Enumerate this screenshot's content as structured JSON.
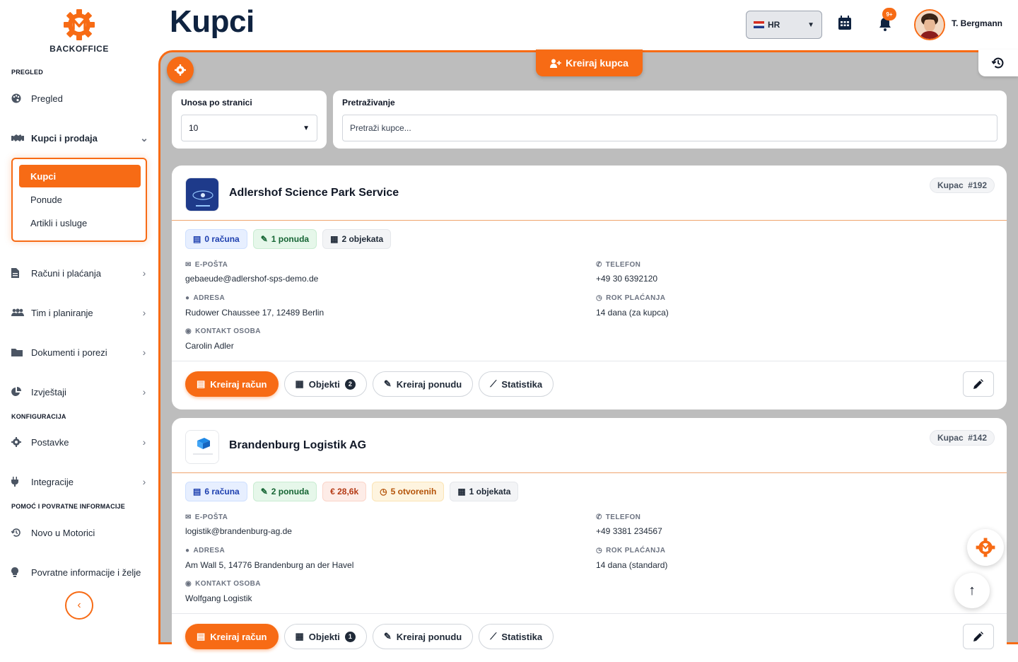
{
  "brand": {
    "name": "BACKOFFICE",
    "accent": "#f76b15",
    "dark": "#0f2340"
  },
  "sidebar": {
    "sections": {
      "overview": "PREGLED",
      "config": "KONFIGURACIJA",
      "help": "POMOĆ I POVRATNE INFORMACIJE"
    },
    "items": {
      "overview": {
        "label": "Pregled",
        "icon": "palette-icon"
      },
      "customers_sales": {
        "label": "Kupci i prodaja",
        "icon": "handshake-icon"
      },
      "invoices": {
        "label": "Računi i plaćanja",
        "icon": "invoice-icon"
      },
      "team": {
        "label": "Tim i planiranje",
        "icon": "users-icon"
      },
      "documents": {
        "label": "Dokumenti i porezi",
        "icon": "folder-icon"
      },
      "reports": {
        "label": "Izvještaji",
        "icon": "pie-chart-icon"
      },
      "settings": {
        "label": "Postavke",
        "icon": "gear-icon"
      },
      "integrations": {
        "label": "Integracije",
        "icon": "plug-icon"
      },
      "news": {
        "label": "Novo u Motorici",
        "icon": "history-icon"
      },
      "feedback": {
        "label": "Povratne informacije i želje",
        "icon": "lightbulb-icon"
      }
    },
    "submenu": [
      {
        "label": "Kupci",
        "active": true
      },
      {
        "label": "Ponude",
        "active": false
      },
      {
        "label": "Artikli i usluge",
        "active": false
      }
    ]
  },
  "header": {
    "title": "Kupci",
    "language": "HR",
    "notifications_badge": "9+",
    "user_name": "T. Bergmann"
  },
  "toolbar": {
    "create_label": "Kreiraj kupca"
  },
  "filters": {
    "per_page_label": "Unosa po stranici",
    "per_page_value": "10",
    "search_label": "Pretraživanje",
    "search_placeholder": "Pretraži kupce..."
  },
  "field_labels": {
    "email": "E-POŠTA",
    "phone": "TELEFON",
    "address": "ADRESA",
    "payment_terms": "ROK PLAĆANJA",
    "contact": "KONTAKT OSOBA"
  },
  "actions": {
    "create_invoice": "Kreiraj račun",
    "objects": "Objekti",
    "create_offer": "Kreiraj ponudu",
    "statistics": "Statistika"
  },
  "customers": [
    {
      "name": "Adlershof Science Park Service",
      "id_label": "Kupac",
      "id": "#192",
      "chips": [
        {
          "text": "0 računa",
          "color": "blue",
          "icon": "invoice-icon"
        },
        {
          "text": "1 ponuda",
          "color": "green",
          "icon": "offer-icon"
        },
        {
          "text": "2 objekata",
          "color": "gray",
          "icon": "building-icon"
        }
      ],
      "email": "gebaeude@adlershof-sps-demo.de",
      "phone": "+49 30 6392120",
      "address": "Rudower Chaussee 17, 12489 Berlin",
      "payment_terms": "14 dana (za kupca)",
      "contact": "Carolin Adler",
      "objects_count": "2"
    },
    {
      "name": "Brandenburg Logistik AG",
      "id_label": "Kupac",
      "id": "#142",
      "chips": [
        {
          "text": "6 računa",
          "color": "blue",
          "icon": "invoice-icon"
        },
        {
          "text": "2 ponuda",
          "color": "green",
          "icon": "offer-icon"
        },
        {
          "text": "€ 28,6k",
          "color": "red",
          "icon": "euro-icon"
        },
        {
          "text": "5 otvorenih",
          "color": "yellow",
          "icon": "clock-icon"
        },
        {
          "text": "1 objekata",
          "color": "gray",
          "icon": "building-icon"
        }
      ],
      "email": "logistik@brandenburg-ag.de",
      "phone": "+49 3381 234567",
      "address": "Am Wall 5, 14776 Brandenburg an der Havel",
      "payment_terms": "14 dana (standard)",
      "contact": "Wolfgang Logistik",
      "objects_count": "1"
    }
  ]
}
